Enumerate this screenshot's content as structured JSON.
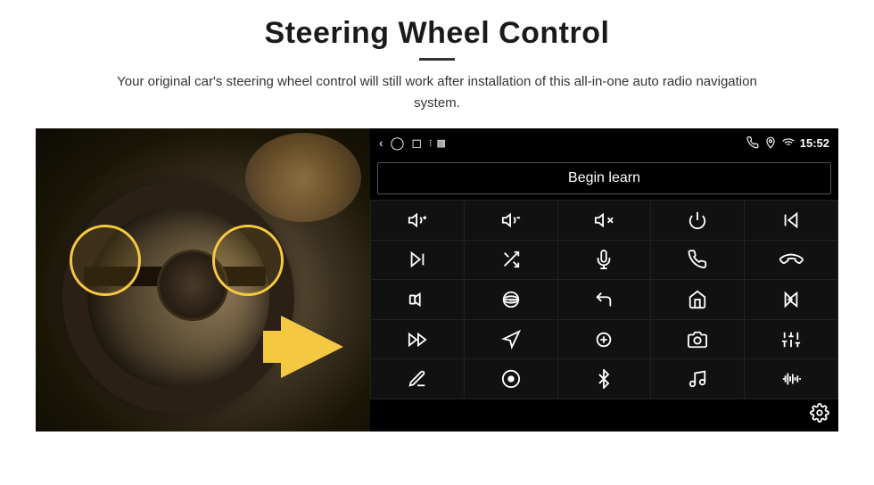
{
  "page": {
    "title": "Steering Wheel Control",
    "divider": true,
    "subtitle": "Your original car's steering wheel control will still work after installation of this all-in-one auto radio navigation system."
  },
  "statusbar": {
    "time": "15:52",
    "icons": [
      "phone",
      "location",
      "wifi",
      "signal"
    ]
  },
  "begin_learn": {
    "label": "Begin learn"
  },
  "grid_icons": [
    "vol-up",
    "vol-down",
    "vol-mute",
    "power",
    "prev-track",
    "next",
    "shuffle",
    "mic",
    "phone",
    "hangup",
    "speaker",
    "360",
    "back",
    "home",
    "skip-back",
    "fast-forward",
    "navigate",
    "equalizer",
    "camera",
    "settings-sliders",
    "edit",
    "circle-dot",
    "bluetooth",
    "music-note",
    "waveform"
  ],
  "settings": {
    "icon": "gear"
  }
}
